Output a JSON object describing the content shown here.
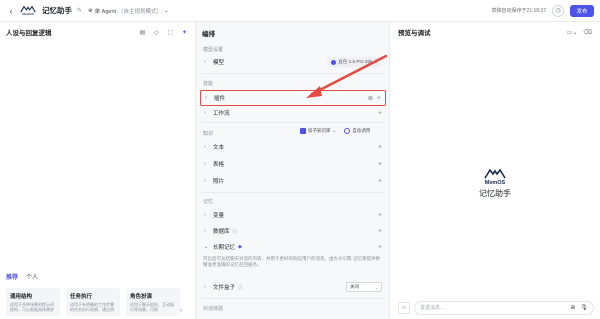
{
  "header": {
    "back": "‹",
    "logo_text": "MemOS",
    "title": "记忆助手",
    "mode_icon": "agent-icon",
    "mode_label": "单 Agent",
    "mode_note": "（自主规划模式）",
    "autosave": "草稿自动保存于21:18:37",
    "publish": "发布"
  },
  "left": {
    "title": "人设与回复逻辑",
    "tabs": [
      "推荐",
      "个人"
    ],
    "cards": [
      {
        "title": "通用结构",
        "desc": "适用于多种场景的提示词结构，可以根据具体需求"
      },
      {
        "title": "任务执行",
        "desc": "适用于有明确的工作步骤的任务执行场景，通过明"
      },
      {
        "title": "角色扮演",
        "desc": "适用于聊天陪伴、互动娱乐等场景，可帮"
      }
    ]
  },
  "mid": {
    "title": "编排",
    "model_section": "模型设置",
    "model_label": "模型",
    "model_value": "豆包·1.5·Pro·32k",
    "skills_section": "技能",
    "plugin": "插件",
    "workflow": "工作流",
    "knowledge_section": "知识",
    "kb_chip": "扣子知识库",
    "auto_call": "自动调用",
    "text": "文本",
    "table": "表格",
    "photo": "照片",
    "memory_section": "记忆",
    "variable": "变量",
    "database": "数据库",
    "long_memory": "长期记忆",
    "long_memory_desc": "开启后可总结聊天对话的内容，并用于更好的响应用户的消息。由大众引擎·记忆库提供更精准更准确的记忆召回服务。",
    "file_box": "文件盒子",
    "file_box_value": "关闭",
    "dialog_section": "对话体验"
  },
  "right": {
    "title": "预览与调试",
    "brand": "MemOS",
    "name": "记忆助手",
    "placeholder": "发送消息..."
  }
}
